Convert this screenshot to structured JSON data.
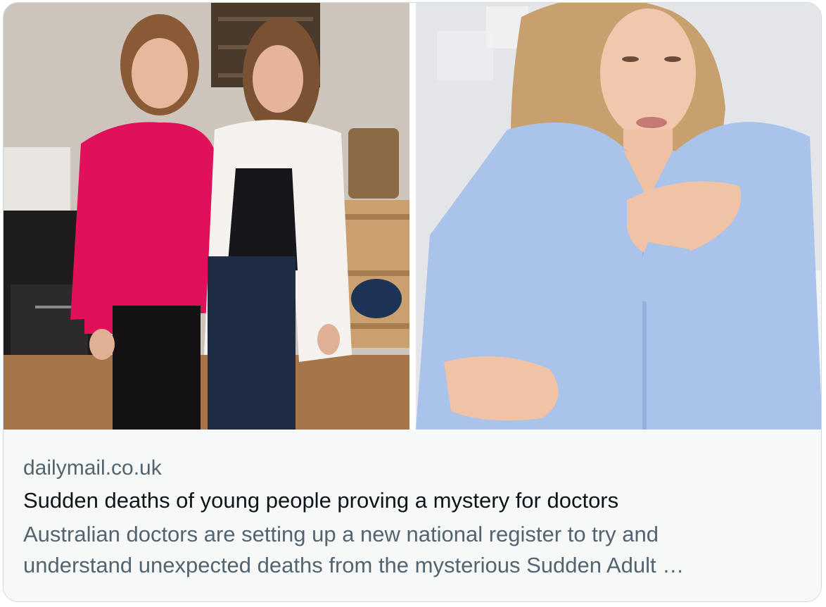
{
  "link_card": {
    "domain": "dailymail.co.uk",
    "title": "Sudden deaths of young people proving a mystery for doctors",
    "description": "Australian doctors are setting up a new national register to try and understand unexpected deaths from the mysterious Sudden Adult …"
  },
  "images": {
    "left": {
      "semantic": "photo-two-women-kitchen"
    },
    "right": {
      "semantic": "photo-woman-hand-on-chest"
    }
  },
  "colors": {
    "card_border": "#cfd9de",
    "meta_background": "#f7f9f9",
    "secondary_text": "#536471",
    "primary_text": "#0f1419"
  }
}
